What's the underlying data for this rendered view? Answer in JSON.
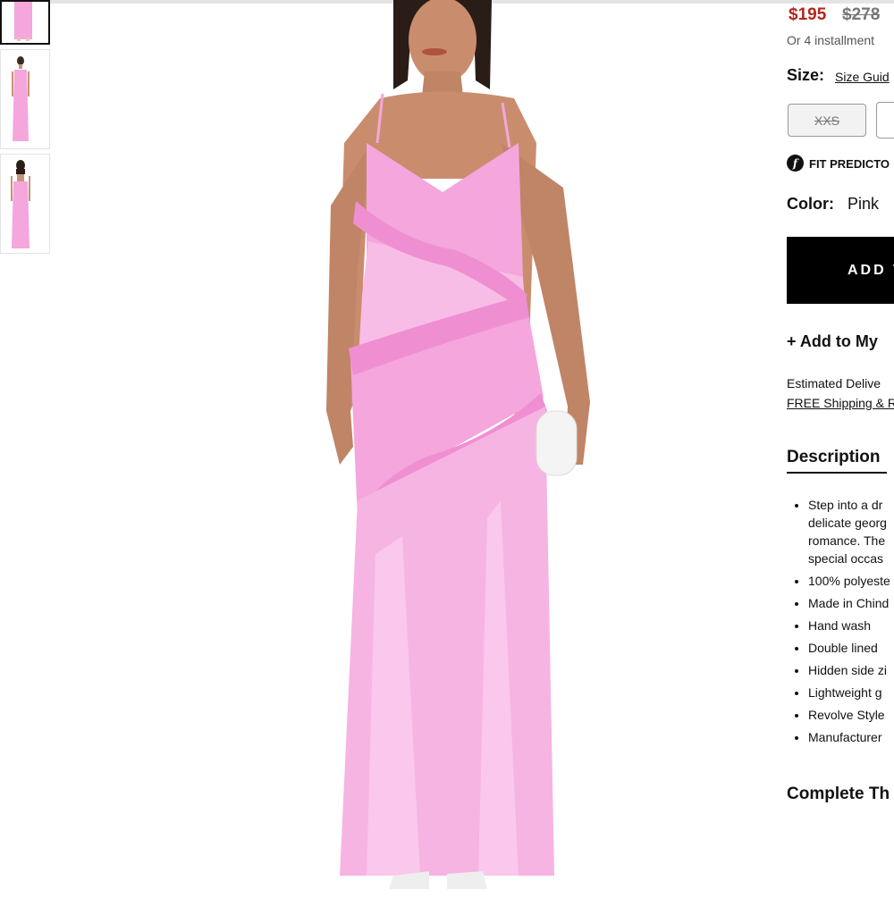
{
  "thumbnails": [
    {
      "name": "thumb-1",
      "selected": true
    },
    {
      "name": "thumb-2",
      "selected": false
    },
    {
      "name": "thumb-3",
      "selected": false
    }
  ],
  "product": {
    "price": "$195",
    "original_price": "$278",
    "installments": "Or 4 installment",
    "size_label": "Size:",
    "size_guide": "Size Guid",
    "sizes": [
      "XXS"
    ],
    "fit_predictor": "FIT PREDICTO",
    "color_label": "Color:",
    "color_value": "Pink",
    "add_button": "ADD T",
    "wishlist": "+ Add to My",
    "estimated_delivery": "Estimated Delive",
    "free_shipping": "FREE Shipping & R",
    "description_title": "Description",
    "description_bullets": [
      [
        "Step into a dr",
        "delicate georg",
        "romance. The",
        "special occas"
      ],
      [
        "100% polyeste"
      ],
      [
        "Made in Chind"
      ],
      [
        "Hand wash"
      ],
      [
        "Double lined"
      ],
      [
        "Hidden side zi"
      ],
      [
        "Lightweight g"
      ],
      [
        "Revolve Style"
      ],
      [
        "Manufacturer"
      ]
    ],
    "complete_the_look": "Complete Th"
  },
  "colors": {
    "price_red": "#b3261e",
    "dress_pink": "#f4a6dd",
    "button_black": "#000000"
  }
}
